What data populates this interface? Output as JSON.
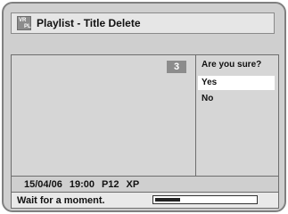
{
  "header": {
    "title": "Playlist - Title Delete",
    "icon": "playlist-icon",
    "icon_text": [
      "VR",
      "PL"
    ]
  },
  "preview": {
    "title_number": "3"
  },
  "confirm": {
    "question": "Are you sure?",
    "options": [
      "Yes",
      "No"
    ],
    "selected": "Yes"
  },
  "info": {
    "date": "15/04/06",
    "time": "19:00",
    "program": "P12",
    "mode": "XP"
  },
  "status": {
    "message": "Wait for a moment.",
    "progress": 0.25
  },
  "colors": {
    "background": "#cfcfcf",
    "highlight": "#ffffff",
    "badge": "#8c8c8c"
  }
}
